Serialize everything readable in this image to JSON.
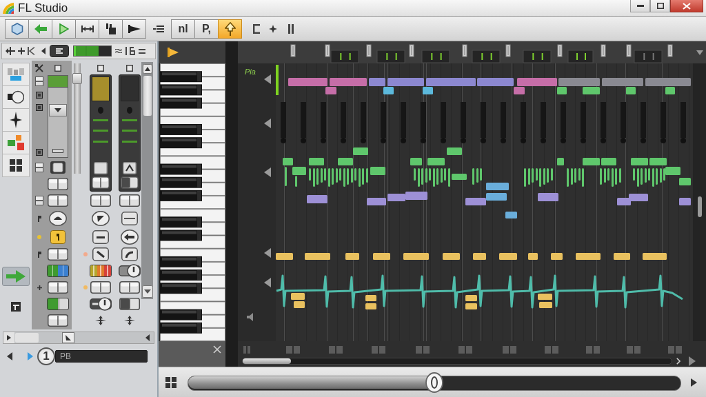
{
  "window": {
    "title": "FL Studio"
  },
  "toolbar": {
    "transport": [
      {
        "selected": false
      },
      {
        "selected": false
      },
      {
        "selected": false
      },
      {
        "selected": false
      },
      {
        "selected": false
      },
      {
        "selected": false
      }
    ],
    "modes": [
      {
        "kind": "text",
        "label": "nl",
        "selected": false
      },
      {
        "kind": "text",
        "label": "P,",
        "selected": false
      },
      {
        "kind": "icon",
        "selected": true
      }
    ]
  },
  "channel_rack": {
    "meter": {
      "level": 0.66
    },
    "tools": [
      {
        "selected": false
      },
      {
        "selected": false
      },
      {
        "selected": false
      },
      {
        "selected": false
      },
      {
        "selected": false
      },
      {
        "selected": true
      }
    ],
    "strips": [
      {
        "kind": "main",
        "color": "#5a9e37",
        "toggle": [
          {
            "color": "#3f9b30"
          },
          {
            "color": "#3b80d0"
          }
        ],
        "dots": [
          {
            "color": "#e8c232"
          }
        ],
        "switch": {
          "on": true
        }
      },
      {
        "kind": "insert",
        "color": "#a68e2c",
        "toggle": [
          {
            "color": "#b6a62c"
          },
          {
            "color": "#e07b2c"
          },
          {
            "color": "#d6423a"
          }
        ],
        "dots": [
          {
            "color": "#f3aa8c"
          },
          {
            "color": "#f1ba62"
          }
        ],
        "switch": {
          "on": true
        }
      },
      {
        "kind": "insert",
        "color": "#2f2f2f",
        "switch": {
          "on": true
        }
      }
    ],
    "fader": {
      "level": 0.9
    },
    "pattern": {
      "number": "1",
      "name": "PB"
    }
  },
  "piano_roll": {
    "label": "Pia",
    "lanes": [
      {
        "kind": "notes",
        "color": "#c66ea8"
      },
      {
        "kind": "notes",
        "color": "#8c88d0"
      },
      {
        "kind": "notes",
        "color": "#8a8a92"
      },
      {
        "kind": "notes",
        "color": "#5cb9dc"
      },
      {
        "kind": "notes",
        "color": "#5fc76c"
      },
      {
        "kind": "notes",
        "color": "#9d90d6"
      },
      {
        "kind": "notes",
        "color": "#6aaedb"
      },
      {
        "kind": "notes",
        "color": "#e9c15f"
      },
      {
        "kind": "curve",
        "color": "#4fbcaa"
      }
    ]
  },
  "position_slider": {
    "level": 0.5
  }
}
